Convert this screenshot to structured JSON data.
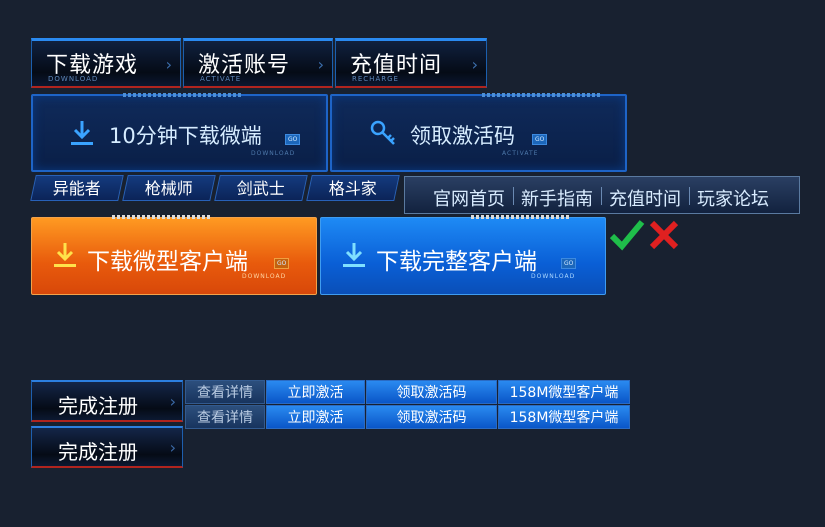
{
  "top_tabs": [
    {
      "title": "下载游戏",
      "subtitle": "DOWNLOAD"
    },
    {
      "title": "激活账号",
      "subtitle": "ACTIVATE"
    },
    {
      "title": "充值时间",
      "subtitle": "RECHARGE"
    }
  ],
  "panels": [
    {
      "label": "10分钟下载微端",
      "go": "GO",
      "subtitle": "DOWNLOAD"
    },
    {
      "label": "领取激活码",
      "go": "GO",
      "subtitle": "ACTIVATE"
    }
  ],
  "class_tabs": [
    "异能者",
    "枪械师",
    "剑武士",
    "格斗家"
  ],
  "nav_items": [
    "官网首页",
    "新手指南",
    "充值时间",
    "玩家论坛"
  ],
  "download_buttons": [
    {
      "label": "下载微型客户端",
      "go": "GO",
      "subtitle": "DOWNLOAD"
    },
    {
      "label": "下载完整客户端",
      "go": "GO",
      "subtitle": "DOWNLOAD"
    }
  ],
  "register_buttons": [
    "完成注册",
    "完成注册"
  ],
  "small_rows": [
    [
      "查看详情",
      "立即激活",
      "领取激活码",
      "158M微型客户端"
    ],
    [
      "查看详情",
      "立即激活",
      "领取激活码",
      "158M微型客户端"
    ]
  ],
  "icons": [
    "check-icon",
    "close-icon",
    "download-icon",
    "key-icon",
    "chevron-right-icon"
  ],
  "colors": {
    "accent_blue": "#1e82f0",
    "accent_orange": "#f07a12",
    "check": "#1fbe4a",
    "close": "#e02020"
  }
}
